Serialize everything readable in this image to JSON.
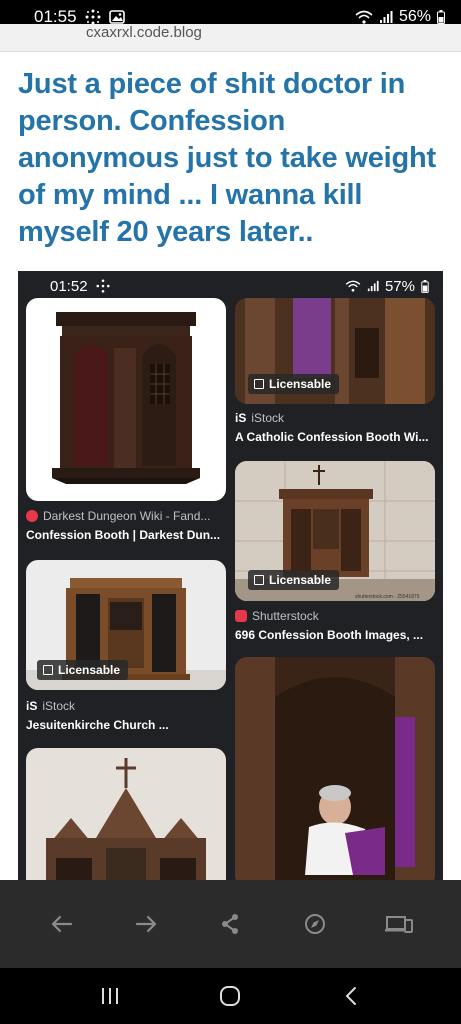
{
  "status_bar": {
    "time": "01:55",
    "battery": "56%"
  },
  "url_bar": {
    "domain": "cxaxrxl.code.blog"
  },
  "post": {
    "title": "Just a piece of shit doctor in person. Confession anonymous just to take weight of my mind ... I wanna kill myself 20 years later.."
  },
  "screenshot": {
    "status_time": "01:52",
    "battery": "57%",
    "results": [
      {
        "source": "Darkest Dungeon Wiki - Fand...",
        "caption": "Confession Booth | Darkest Dun...",
        "licensable": ""
      },
      {
        "source": "iStock",
        "caption": "A Catholic Confession Booth Wi...",
        "licensable": "Licensable"
      },
      {
        "source": "Shutterstock",
        "caption": "696 Confession Booth Images, ...",
        "licensable": "Licensable"
      },
      {
        "source": "iStock",
        "caption": "Jesuitenkirche Church ...",
        "licensable": "Licensable"
      }
    ],
    "watermark": "shutterstock.com · 25541875"
  },
  "browser_nav": {
    "icons": [
      "back-icon",
      "forward-icon",
      "share-icon",
      "compass-icon",
      "tabs-icon"
    ]
  },
  "system_nav": {
    "icons": [
      "recents-icon",
      "home-icon",
      "back-icon"
    ]
  },
  "colors": {
    "title": "#2574a9",
    "shot_bg": "#202124",
    "navbar_bg": "#2b2b2b"
  }
}
